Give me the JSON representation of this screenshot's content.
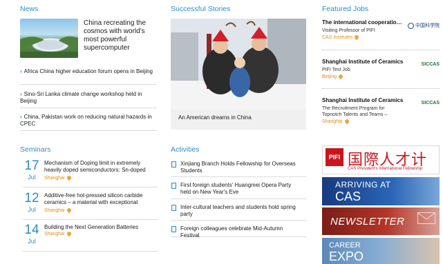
{
  "news": {
    "title": "News",
    "lead": "China recreating the cosmos with world's most powerful supercomputer",
    "items": [
      "Africa China higher education forum opens in Beijing",
      "Sino-Sri Lanka climate change workshop held in Beijing",
      "China, Pakistan work on reducing natural hazards in CPEC"
    ]
  },
  "stories": {
    "title": "Successful Stories",
    "caption": "An American dreams in China"
  },
  "jobs": {
    "title": "Featured Jobs",
    "items": [
      {
        "title": "The international cooperation...",
        "desc": "Visiting Professor of PIFI",
        "location": "CAS Institutes",
        "logo": "中国科学院"
      },
      {
        "title": "Shanghai Institute of Ceramics",
        "desc": "PIFI Test Job",
        "location": "Beijing",
        "logo": "SICCAS"
      },
      {
        "title": "Shanghai Institute of Ceramics",
        "desc": "The Recruitment Program for Topnotch Talents and Teams –",
        "location": "Shanghai",
        "logo": "SICCAS"
      }
    ]
  },
  "seminars": {
    "title": "Seminars",
    "items": [
      {
        "day": "17",
        "month": "Jul",
        "title": "Mechanism of Doping limit in extremely heavily doped semiconductors: Sn-doped",
        "location": "Shanghai"
      },
      {
        "day": "12",
        "month": "Jul",
        "title": "Additive-free hot-pressed silicon carbide ceramics – a material with exceptional",
        "location": "Shanghai"
      },
      {
        "day": "14",
        "month": "Jul",
        "title": "Building the Next Generation Batteries",
        "location": "Shanghai"
      }
    ]
  },
  "activities": {
    "title": "Activities",
    "items": [
      "Xinjiang Branch Holds Fellowship for Overseas Students",
      "First foreign students' Huangmei Opera Party held on New Year's Eve",
      "Inter-cultural teachers and students hold spring party",
      "Foreign colleagues celebrate Mid-Autumn Festival"
    ]
  },
  "banners": {
    "pifi_mark": "PIFI",
    "pifi_cn": "国際人才计划",
    "pifi_sub": "CAS President's International Fellowship",
    "arriving_l1": "ARRIVING AT",
    "arriving_l2": "CAS",
    "newsletter": "NEWSLETTER",
    "career_l1": "CAREER",
    "career_l2": "EXPO"
  }
}
